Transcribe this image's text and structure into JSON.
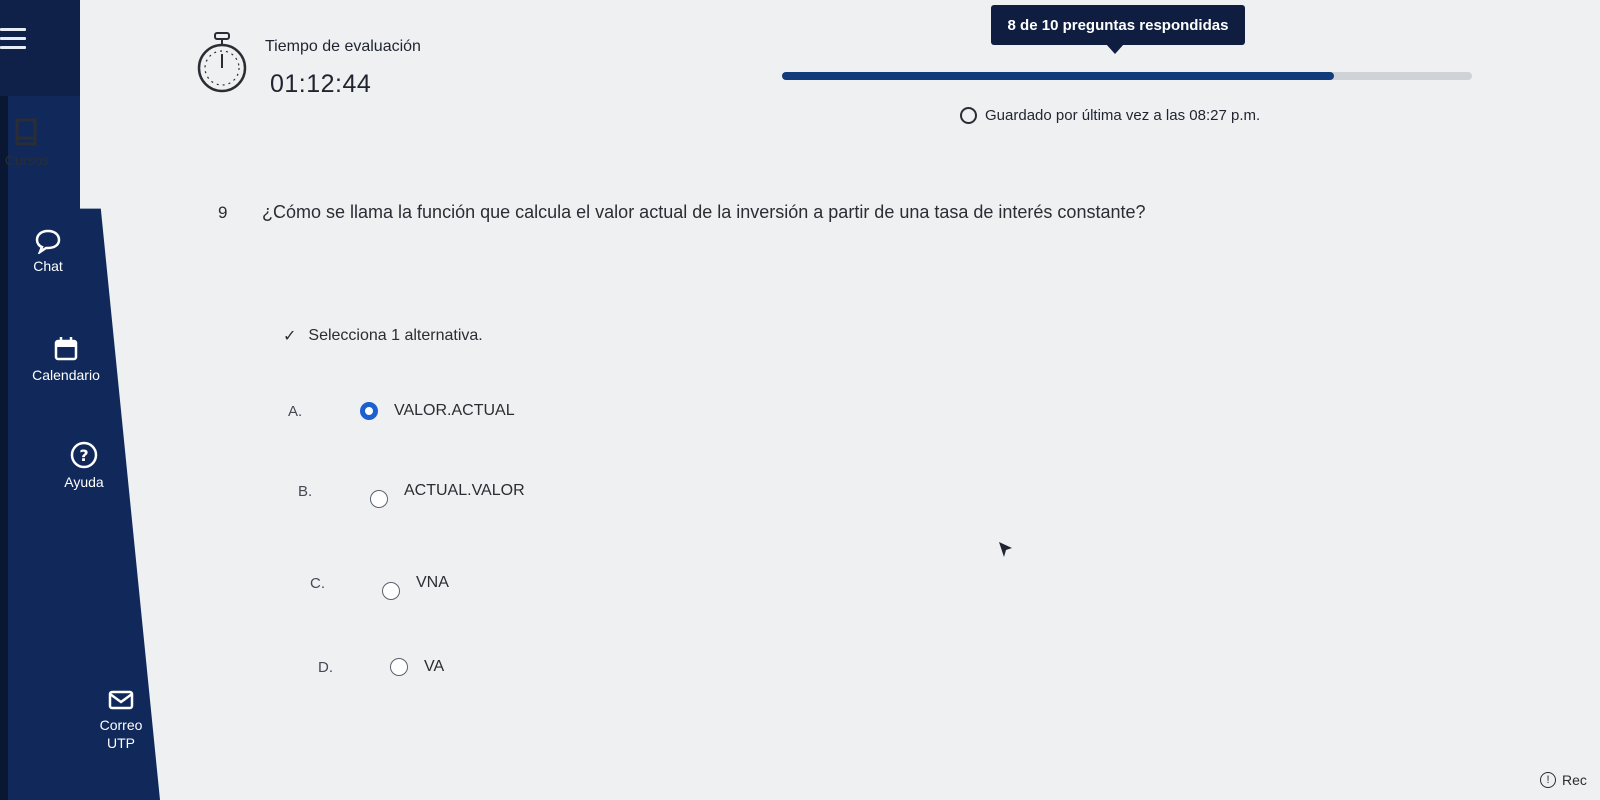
{
  "sidebar": {
    "items": [
      {
        "label": "Cursos",
        "icon": "book-icon"
      },
      {
        "label": "Chat",
        "icon": "chat-bubble-icon"
      },
      {
        "label": "Calendario",
        "icon": "calendar-icon"
      },
      {
        "label": "Ayuda",
        "icon": "help-circle-icon"
      },
      {
        "label_line1": "Correo",
        "label_line2": "UTP",
        "icon": "mail-icon"
      }
    ]
  },
  "header": {
    "timer_label": "Tiempo de evaluación",
    "timer_value": "01:12:44",
    "progress_text": "8 de 10 preguntas respondidas",
    "answered": 8,
    "total": 10,
    "saved_text": "Guardado por última vez a las 08:27 p.m."
  },
  "question": {
    "number": "9",
    "text": "¿Cómo se llama la función que calcula el valor actual de la inversión a partir de una tasa de interés constante?",
    "instruction": "Selecciona 1 alternativa.",
    "options": [
      {
        "letter": "A.",
        "label": "VALOR.ACTUAL",
        "selected": true
      },
      {
        "letter": "B.",
        "label": "ACTUAL.VALOR",
        "selected": false
      },
      {
        "letter": "C.",
        "label": "VNA",
        "selected": false
      },
      {
        "letter": "D.",
        "label": "VA",
        "selected": false
      }
    ]
  },
  "footer": {
    "review_label": "Rec"
  },
  "colors": {
    "sidebar": "#11295a",
    "accent": "#1d5fcf",
    "progress": "#133a7a"
  }
}
